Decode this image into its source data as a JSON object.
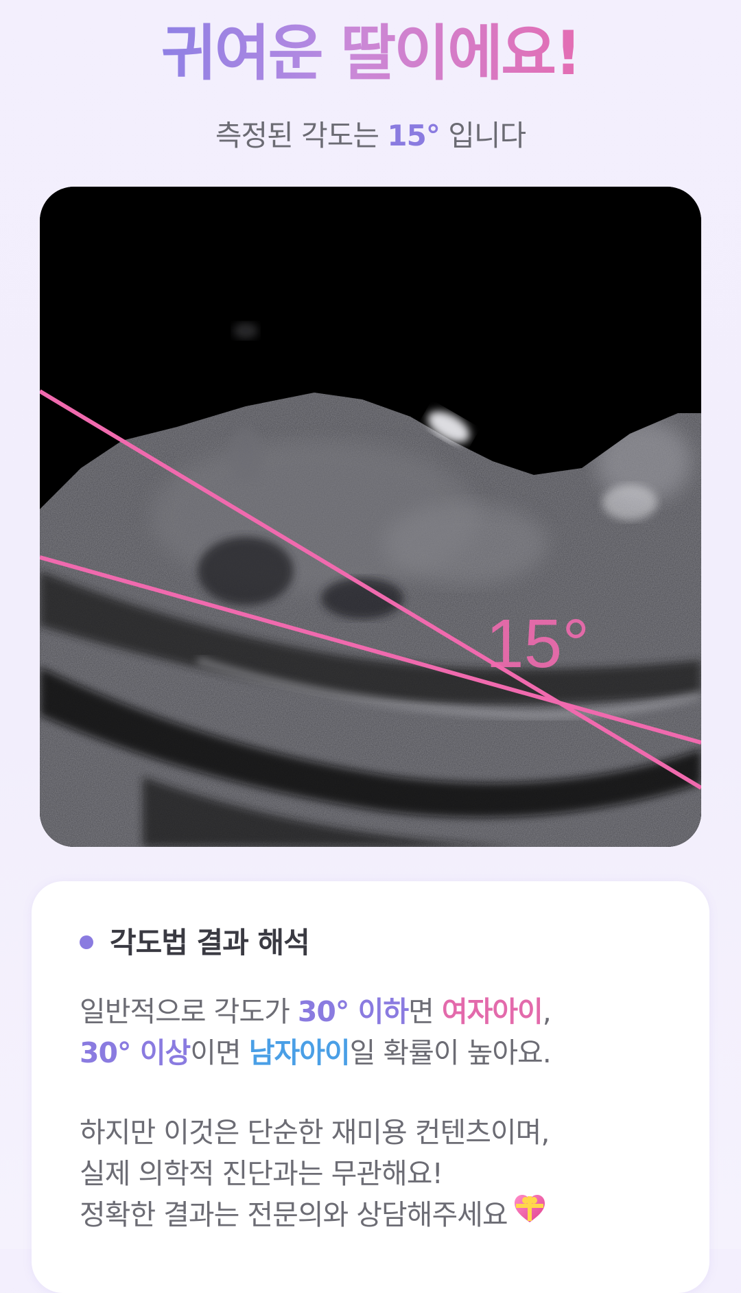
{
  "header": {
    "title_part1": "귀여운 ",
    "title_part2": "딸이에요!",
    "subtitle_prefix": "측정된 각도는 ",
    "subtitle_angle": "15°",
    "subtitle_suffix": " 입니다"
  },
  "ultrasound": {
    "angle_label": "15°",
    "line_color": "#f06aae"
  },
  "card": {
    "heading": "각도법 결과 해석",
    "line1_prefix": "일반적으로 각도가 ",
    "line1_threshold": "30° 이하",
    "line1_mid": "면 ",
    "line1_girl": "여자아이",
    "line1_end": ",",
    "line2_threshold": "30° 이상",
    "line2_mid": "이면 ",
    "line2_boy": "남자아이",
    "line2_end": "일 확률이 높아요.",
    "line3": "하지만 이것은 단순한 재미용 컨텐츠이며,",
    "line4": "실제 의학적 진단과는 무관해요!",
    "line5": "정확한 결과는 전문의와 상담해주세요",
    "heart_icon": "gift-heart-icon"
  },
  "colors": {
    "accent_purple": "#8a7be0",
    "accent_pink": "#e36aab",
    "accent_blue": "#4a9fe6"
  }
}
